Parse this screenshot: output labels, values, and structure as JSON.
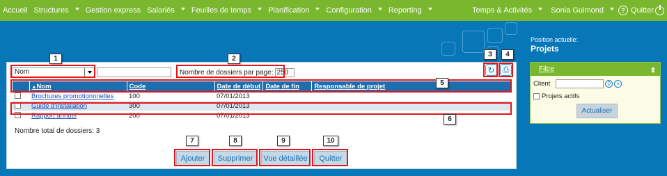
{
  "nav": {
    "items": [
      {
        "label": "Accueil",
        "caret": false
      },
      {
        "label": "Structures",
        "caret": true
      },
      {
        "label": "Gestion express",
        "caret": false
      },
      {
        "label": "Salariés",
        "caret": true
      },
      {
        "label": "Feuilles de temps",
        "caret": true
      },
      {
        "label": "Planification",
        "caret": true
      },
      {
        "label": "Configuration",
        "caret": true
      },
      {
        "label": "Reporting",
        "caret": true
      }
    ],
    "right": {
      "activities": "Temps & Activités",
      "user": "Sonia Guimond",
      "help_icon": "question-circle-icon",
      "quit": "Quitter",
      "quit_icon": "power-icon"
    },
    "color": "#78b72e"
  },
  "toolbar": {
    "sort_field": "Nom",
    "search_value": "",
    "per_page_label": "Nombre de dossiers par page:",
    "per_page_value": "250",
    "refresh_icon": "refresh-icon",
    "print_icon": "print-icon"
  },
  "table": {
    "columns": [
      "Nom",
      "Code",
      "Date de début",
      "Date de fin",
      "Responsable de projet"
    ],
    "rows": [
      {
        "nom": "Brochures promotionnnelles",
        "code": "100",
        "debut": "07/01/2013",
        "fin": "",
        "responsable": ""
      },
      {
        "nom": "Guide d'installation",
        "code": "300",
        "debut": "07/01/2013",
        "fin": "",
        "responsable": ""
      },
      {
        "nom": "Rapport annuel",
        "code": "200",
        "debut": "07/01/2013",
        "fin": "",
        "responsable": ""
      }
    ],
    "total_label": "Nombre total de dossiers: 3",
    "header_color": "#1b6fae"
  },
  "buttons": {
    "add": "Ajouter",
    "delete": "Supprimer",
    "detail": "Vue détaillée",
    "quit": "Quitter"
  },
  "callouts": [
    "1",
    "2",
    "3",
    "4",
    "5",
    "6",
    "7",
    "8",
    "9",
    "10"
  ],
  "side": {
    "position_label": "Position actuelle:",
    "position_title": "Projets",
    "filter": {
      "title": "Filtre",
      "client_label": "Client",
      "client_value": "",
      "active_label": "Projets actifs",
      "refresh_button": "Actualiser"
    }
  }
}
